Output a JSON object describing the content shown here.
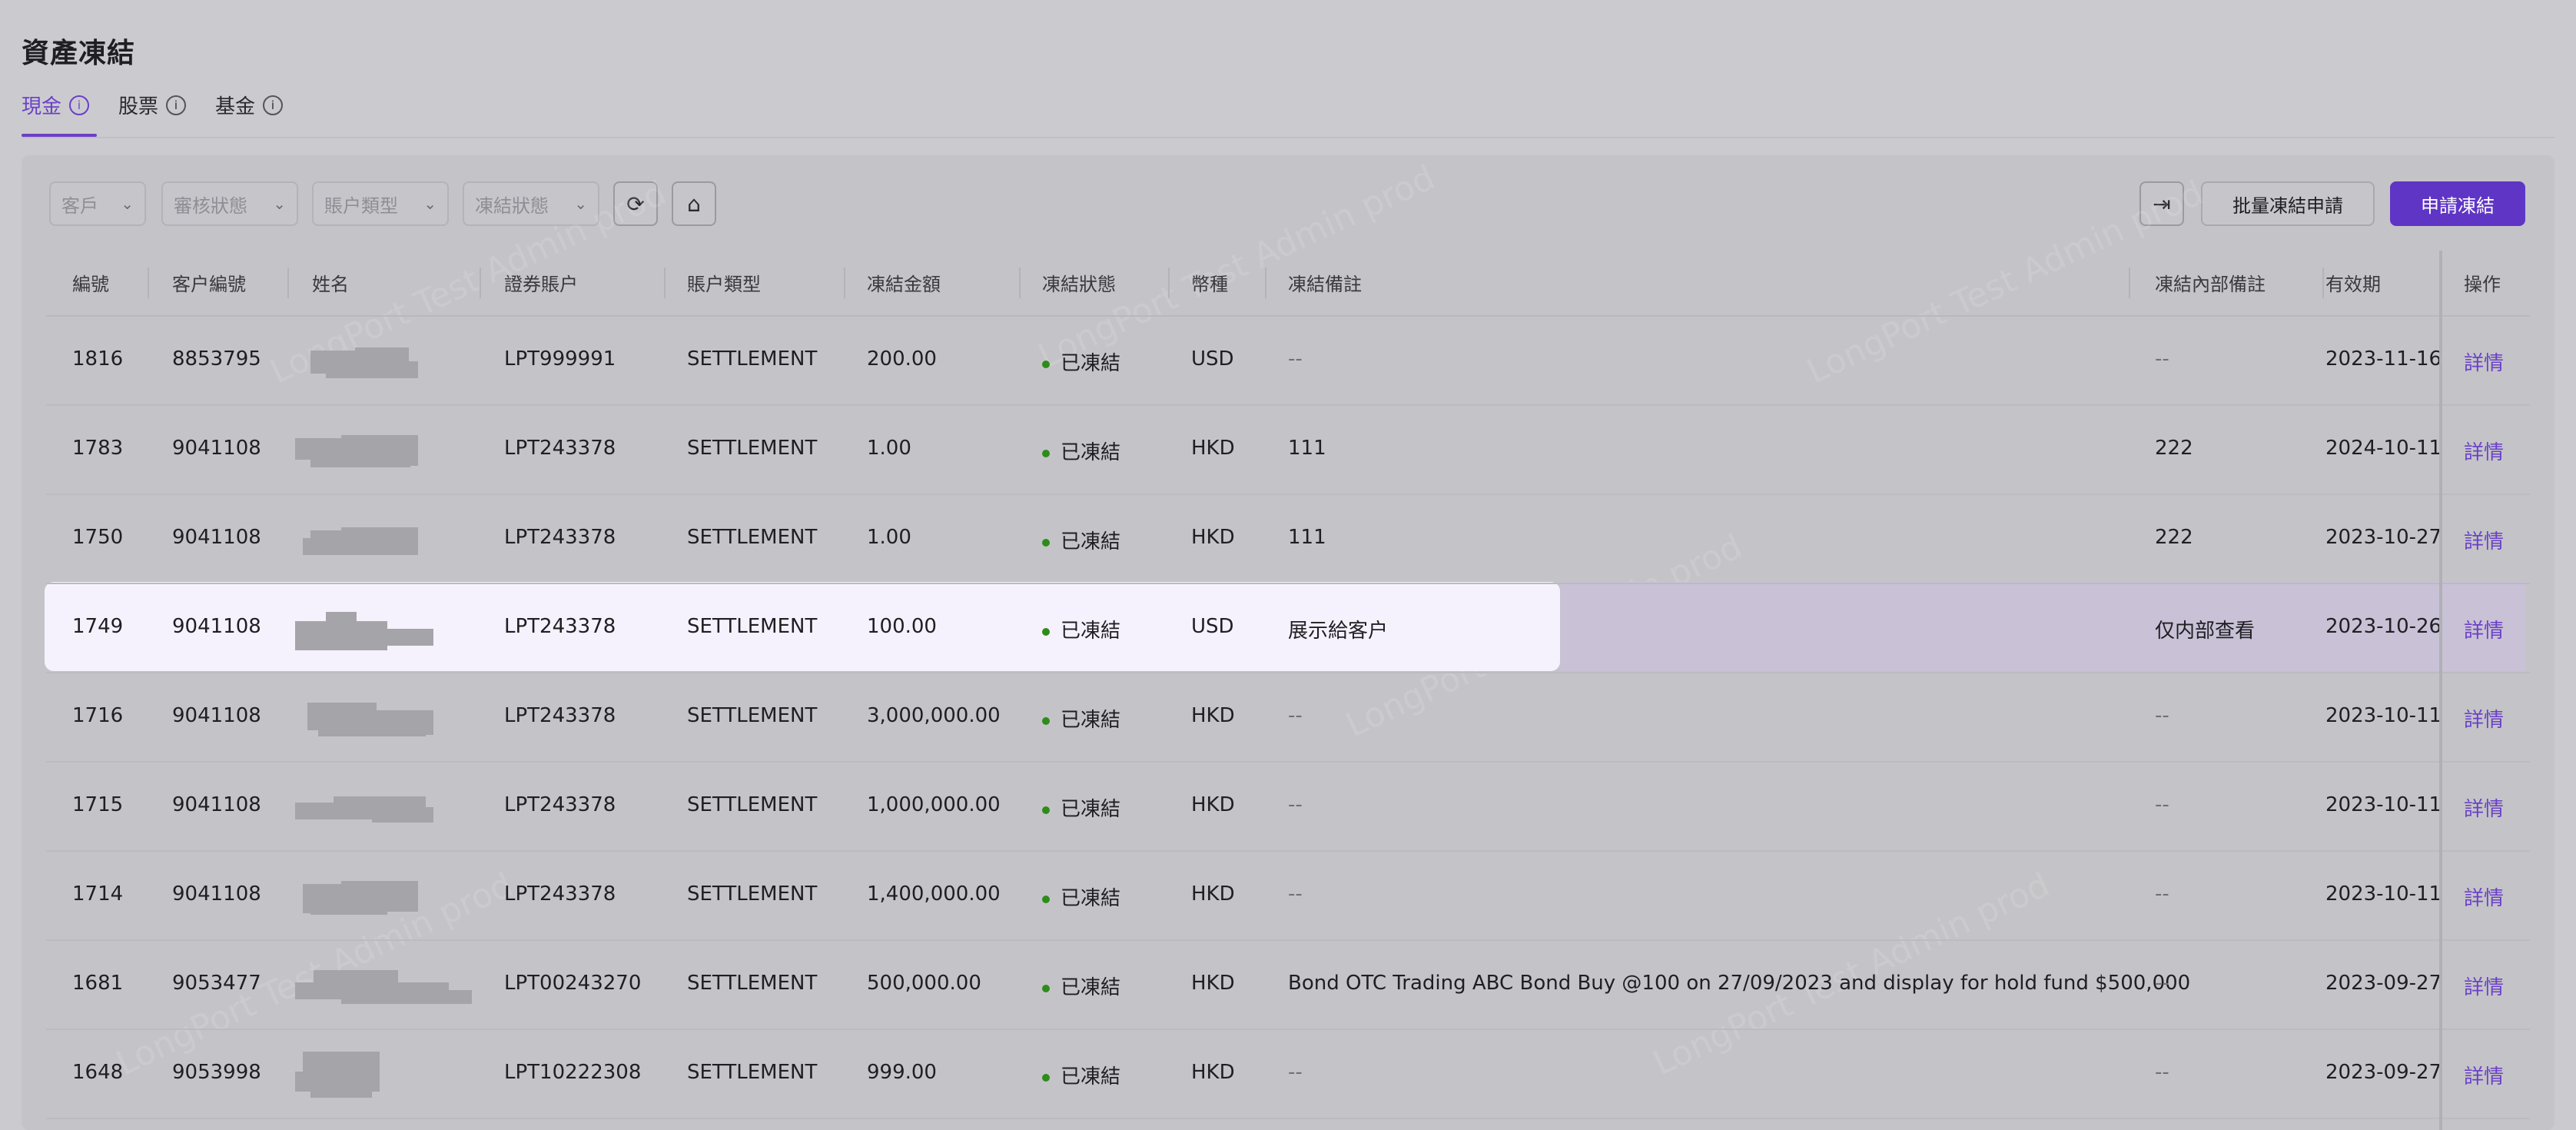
{
  "page": {
    "title": "資產凍結"
  },
  "tabs": [
    {
      "label": "現金",
      "active": true
    },
    {
      "label": "股票",
      "active": false
    },
    {
      "label": "基金",
      "active": false
    }
  ],
  "filters": {
    "customer": "客戶",
    "review_status": "審核狀態",
    "account_type": "賬户類型",
    "freeze_status": "凍結狀態"
  },
  "actions": {
    "batch_label": "批量凍結申請",
    "apply_label": "申請凍結"
  },
  "table": {
    "headers": {
      "id": "編號",
      "cust": "客户編號",
      "name": "姓名",
      "acct": "證券賬户",
      "type": "賬户類型",
      "amount": "凍結金額",
      "status": "凍結狀態",
      "currency": "幣種",
      "remark": "凍結備註",
      "internal": "凍結內部備註",
      "expiry": "有效期",
      "ops": "操作"
    },
    "rows": [
      {
        "id": "1816",
        "cust": "8853795",
        "acct": "LPT999991",
        "type": "SETTLEMENT",
        "amount": "200.00",
        "status": "已凍結",
        "currency": "USD",
        "remark": "--",
        "internal": "--",
        "expiry": "2023-11-16",
        "op": "詳情"
      },
      {
        "id": "1783",
        "cust": "9041108",
        "acct": "LPT243378",
        "type": "SETTLEMENT",
        "amount": "1.00",
        "status": "已凍結",
        "currency": "HKD",
        "remark": "111",
        "internal": "222",
        "expiry": "2024-10-11",
        "op": "詳情"
      },
      {
        "id": "1750",
        "cust": "9041108",
        "acct": "LPT243378",
        "type": "SETTLEMENT",
        "amount": "1.00",
        "status": "已凍結",
        "currency": "HKD",
        "remark": "111",
        "internal": "222",
        "expiry": "2023-10-27",
        "op": "詳情"
      },
      {
        "id": "1749",
        "cust": "9041108",
        "acct": "LPT243378",
        "type": "SETTLEMENT",
        "amount": "100.00",
        "status": "已凍結",
        "currency": "USD",
        "remark": "展示給客户",
        "internal": "仅内部查看",
        "expiry": "2023-10-26",
        "op": "詳情"
      },
      {
        "id": "1716",
        "cust": "9041108",
        "acct": "LPT243378",
        "type": "SETTLEMENT",
        "amount": "3,000,000.00",
        "status": "已凍結",
        "currency": "HKD",
        "remark": "--",
        "internal": "--",
        "expiry": "2023-10-11",
        "op": "詳情"
      },
      {
        "id": "1715",
        "cust": "9041108",
        "acct": "LPT243378",
        "type": "SETTLEMENT",
        "amount": "1,000,000.00",
        "status": "已凍結",
        "currency": "HKD",
        "remark": "--",
        "internal": "--",
        "expiry": "2023-10-11",
        "op": "詳情"
      },
      {
        "id": "1714",
        "cust": "9041108",
        "acct": "LPT243378",
        "type": "SETTLEMENT",
        "amount": "1,400,000.00",
        "status": "已凍結",
        "currency": "HKD",
        "remark": "--",
        "internal": "--",
        "expiry": "2023-10-11",
        "op": "詳情"
      },
      {
        "id": "1681",
        "cust": "9053477",
        "acct": "LPT00243270",
        "type": "SETTLEMENT",
        "amount": "500,000.00",
        "status": "已凍結",
        "currency": "HKD",
        "remark": "Bond OTC Trading ABC Bond Buy @100 on 27/09/2023 and display for hold fund $500,000",
        "internal": "--",
        "expiry": "2023-09-27",
        "op": "詳情"
      },
      {
        "id": "1648",
        "cust": "9053998",
        "acct": "LPT10222308",
        "type": "SETTLEMENT",
        "amount": "999.00",
        "status": "已凍結",
        "currency": "HKD",
        "remark": "--",
        "internal": "--",
        "expiry": "2023-09-27",
        "op": "詳情"
      }
    ]
  },
  "watermark": "LongPort Test Admin prod",
  "colors": {
    "accent": "#6a40c7",
    "primary_button": "#5f35c5",
    "status_green": "#2e8c1a",
    "highlight_row": "#f6f2fd"
  }
}
